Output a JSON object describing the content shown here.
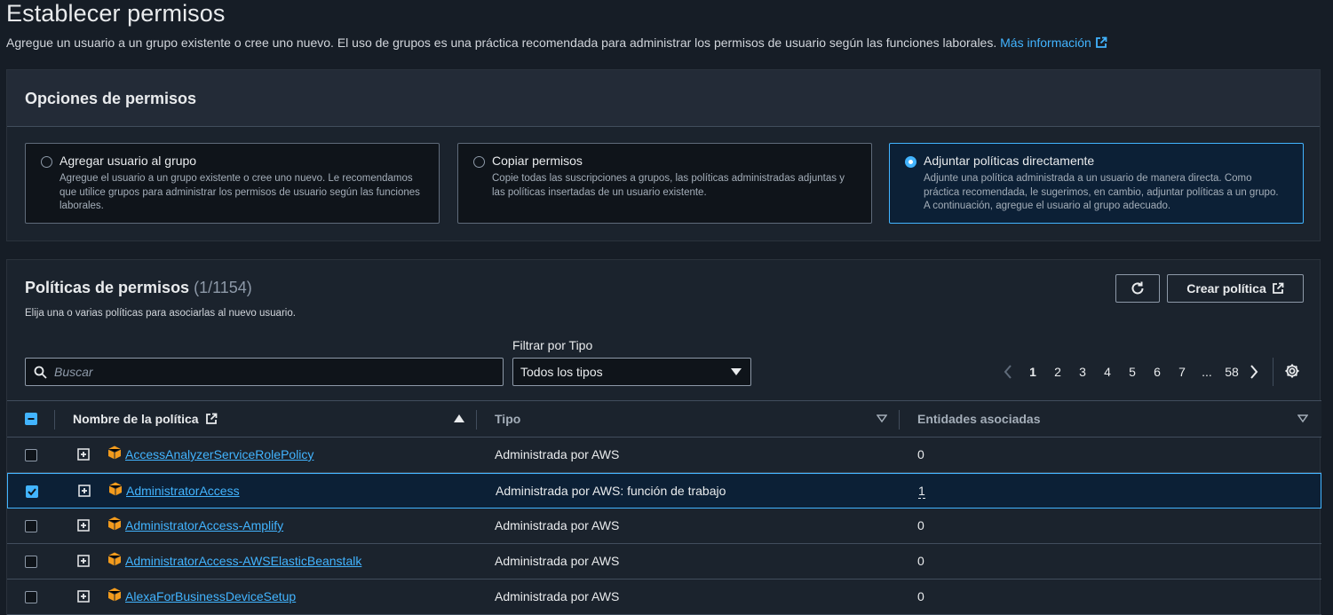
{
  "page": {
    "title": "Establecer permisos",
    "description": "Agregue un usuario a un grupo existente o cree uno nuevo. El uso de grupos es una práctica recomendada para administrar los permisos de usuario según las funciones laborales.",
    "more_info": "Más información"
  },
  "options_panel": {
    "title": "Opciones de permisos",
    "options": [
      {
        "label": "Agregar usuario al grupo",
        "desc": "Agregue el usuario a un grupo existente o cree uno nuevo. Le recomendamos que utilice grupos para administrar los permisos de usuario según las funciones laborales.",
        "selected": false
      },
      {
        "label": "Copiar permisos",
        "desc": "Copie todas las suscripciones a grupos, las políticas administradas adjuntas y las políticas insertadas de un usuario existente.",
        "selected": false
      },
      {
        "label": "Adjuntar políticas directamente",
        "desc": "Adjunte una política administrada a un usuario de manera directa. Como práctica recomendada, le sugerimos, en cambio, adjuntar políticas a un grupo. A continuación, agregue el usuario al grupo adecuado.",
        "selected": true
      }
    ]
  },
  "policies_panel": {
    "title": "Políticas de permisos",
    "count": "(1/1154)",
    "subtitle": "Elija una o varias políticas para asociarlas al nuevo usuario.",
    "create_button": "Crear política",
    "filter_label": "Filtrar por Tipo",
    "search_placeholder": "Buscar",
    "type_select_value": "Todos los tipos",
    "pagination": {
      "pages": [
        "1",
        "2",
        "3",
        "4",
        "5",
        "6",
        "7",
        "...",
        "58"
      ],
      "current": "1"
    },
    "columns": {
      "name": "Nombre de la política",
      "type": "Tipo",
      "entities": "Entidades asociadas"
    },
    "rows": [
      {
        "name": "AccessAnalyzerServiceRolePolicy",
        "type": "Administrada por AWS",
        "entities": "0",
        "checked": false
      },
      {
        "name": "AdministratorAccess",
        "type": "Administrada por AWS: función de trabajo",
        "entities": "1",
        "checked": true
      },
      {
        "name": "AdministratorAccess-Amplify",
        "type": "Administrada por AWS",
        "entities": "0",
        "checked": false
      },
      {
        "name": "AdministratorAccess-AWSElasticBeanstalk",
        "type": "Administrada por AWS",
        "entities": "0",
        "checked": false
      },
      {
        "name": "AlexaForBusinessDeviceSetup",
        "type": "Administrada por AWS",
        "entities": "0",
        "checked": false
      }
    ]
  },
  "colors": {
    "accent": "#42b4ff",
    "background": "#161d26",
    "panel": "#1b232d",
    "aws_orange": "#f29b1d"
  }
}
